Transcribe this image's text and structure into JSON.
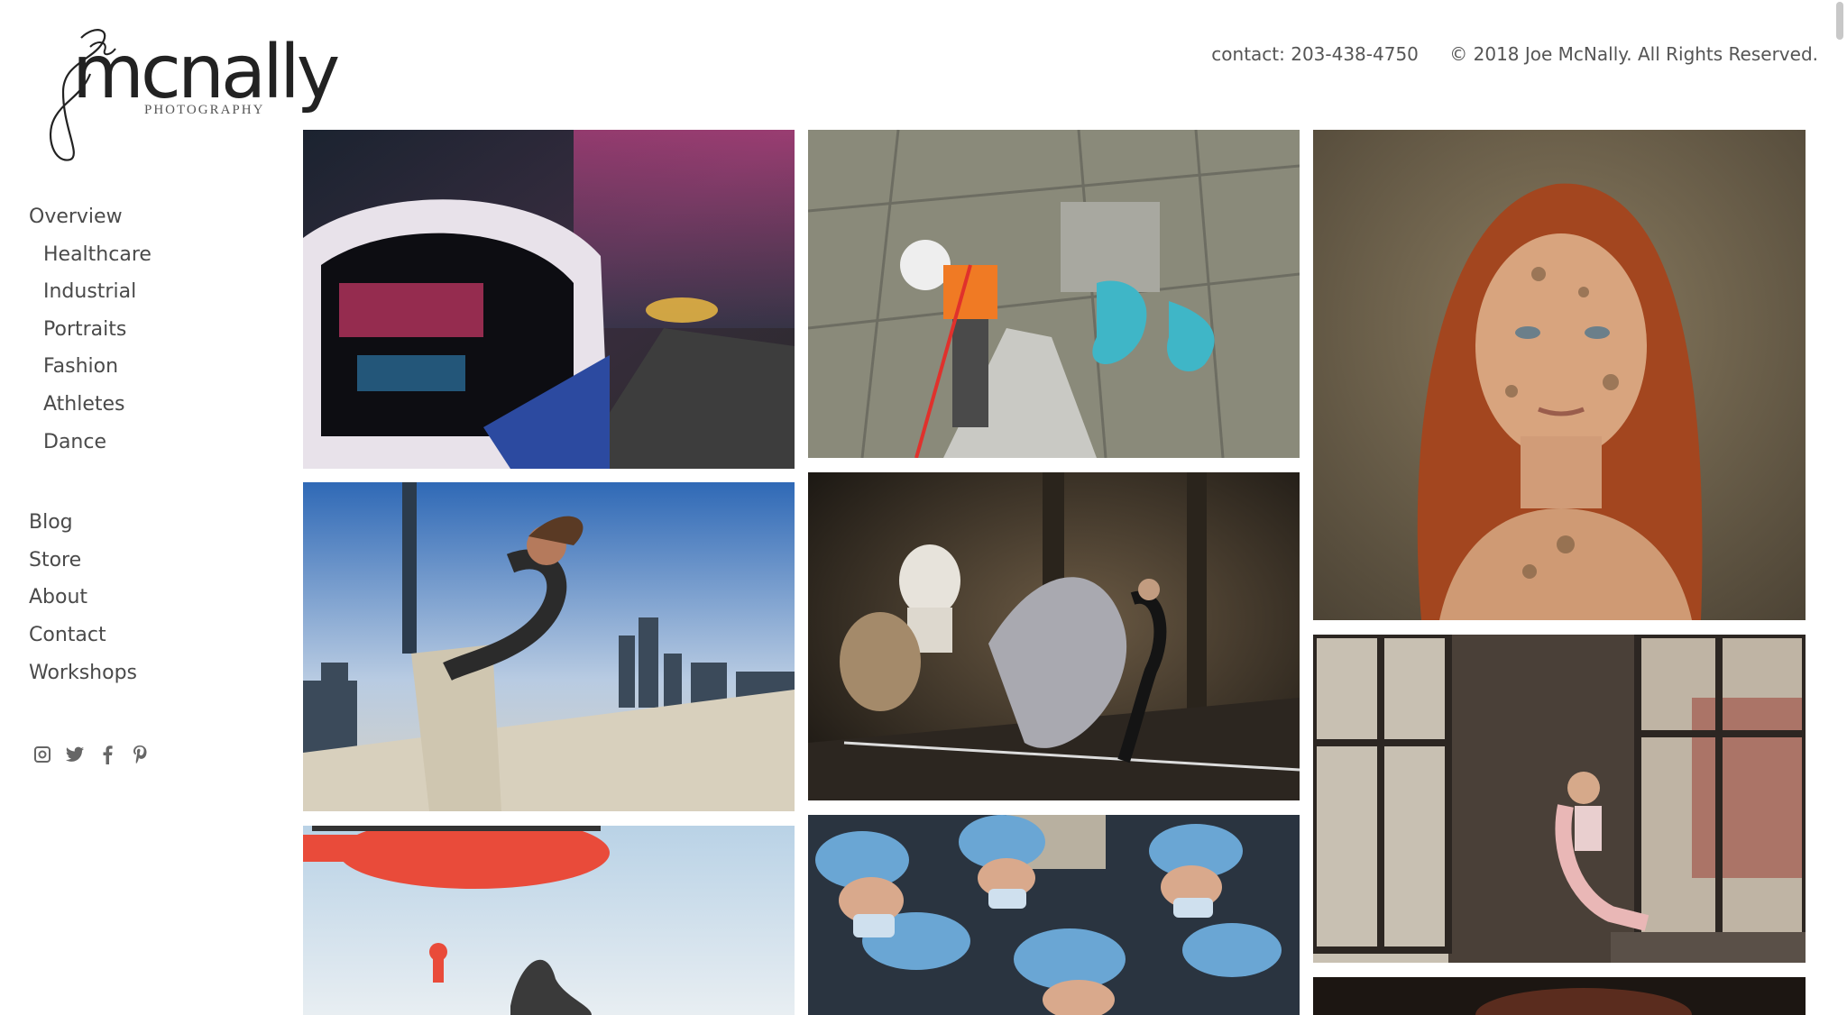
{
  "logo": {
    "script_initials": "Joe",
    "wordmark": "mcnally",
    "subtitle": "PHOTOGRAPHY"
  },
  "header": {
    "contact": "contact: 203-438-4750",
    "copyright": "© 2018 Joe McNally. All Rights Reserved."
  },
  "nav": {
    "overview": "Overview",
    "sub_items": [
      "Healthcare",
      "Industrial",
      "Portraits",
      "Fashion",
      "Athletes",
      "Dance"
    ],
    "main_items": [
      "Blog",
      "Store",
      "About",
      "Contact",
      "Workshops"
    ]
  },
  "social": [
    "instagram-icon",
    "twitter-icon",
    "facebook-icon",
    "pinterest-icon"
  ],
  "colors": {
    "text": "#5a5a5a",
    "background": "#ffffff"
  }
}
